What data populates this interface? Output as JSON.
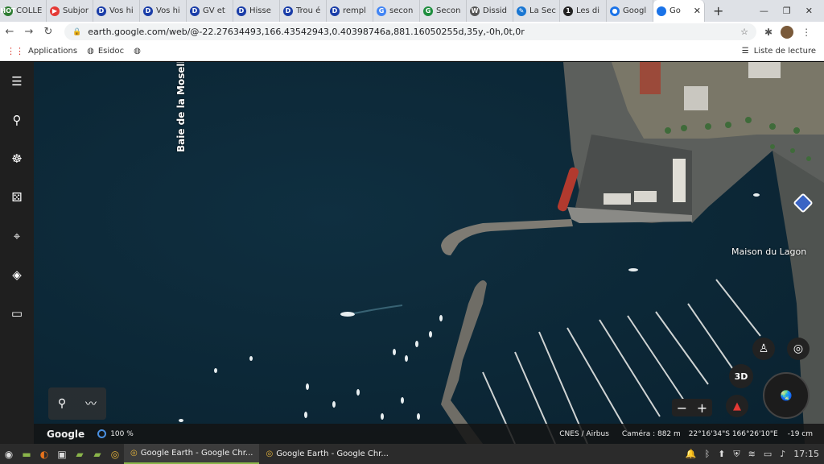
{
  "tabs": [
    {
      "label": "COLLE",
      "fav": "HOT",
      "color": "#2e7d32"
    },
    {
      "label": "Subjor",
      "fav": "▶",
      "color": "#e53935"
    },
    {
      "label": "Vos hi",
      "fav": "D",
      "color": "#1a3da8"
    },
    {
      "label": "Vos hi",
      "fav": "D",
      "color": "#1a3da8"
    },
    {
      "label": "GV et",
      "fav": "D",
      "color": "#1a3da8"
    },
    {
      "label": "Hisse",
      "fav": "D",
      "color": "#1a3da8"
    },
    {
      "label": "Trou é",
      "fav": "D",
      "color": "#1a3da8"
    },
    {
      "label": "rempl",
      "fav": "D",
      "color": "#1a3da8"
    },
    {
      "label": "secon",
      "fav": "G",
      "color": "#4285f4"
    },
    {
      "label": "Secon",
      "fav": "G",
      "color": "#1e8e3e"
    },
    {
      "label": "Dissid",
      "fav": "W",
      "color": "#555555"
    },
    {
      "label": "La Sec",
      "fav": "✎",
      "color": "#1976d2"
    },
    {
      "label": "Les di",
      "fav": "1",
      "color": "#222222"
    },
    {
      "label": "Googl",
      "fav": "●",
      "color": "#1a73e8"
    }
  ],
  "active_tab": {
    "label": "Go",
    "fav": "●",
    "color": "#1a73e8"
  },
  "address": {
    "url": "earth.google.com/web/@-22.27634493,166.43542943,0.40398746a,881.16050255d,35y,-0h,0t,0r"
  },
  "bookmarks": {
    "apps": "Applications",
    "esidoc": "Esidoc",
    "reading_list": "Liste de lecture"
  },
  "map_labels": {
    "bay": "Baie de la Moselle",
    "place": "Maison du Lagon"
  },
  "controls": {
    "mode_3d": "3D"
  },
  "status": {
    "brand": "Google",
    "zoom": "100 %",
    "credits": "CNES / Airbus",
    "camera": "Caméra : 882 m",
    "coords": "22°16'34\"S 166°26'10\"E",
    "elevation": "-19 cm"
  },
  "taskbar": {
    "win1": "Google Earth - Google Chr...",
    "win2": "Google Earth - Google Chr...",
    "time": "17:15"
  },
  "colors": {
    "sea": "#0c2a3a",
    "sidebar": "#1f1f1f",
    "accent": "#1a73e8"
  }
}
